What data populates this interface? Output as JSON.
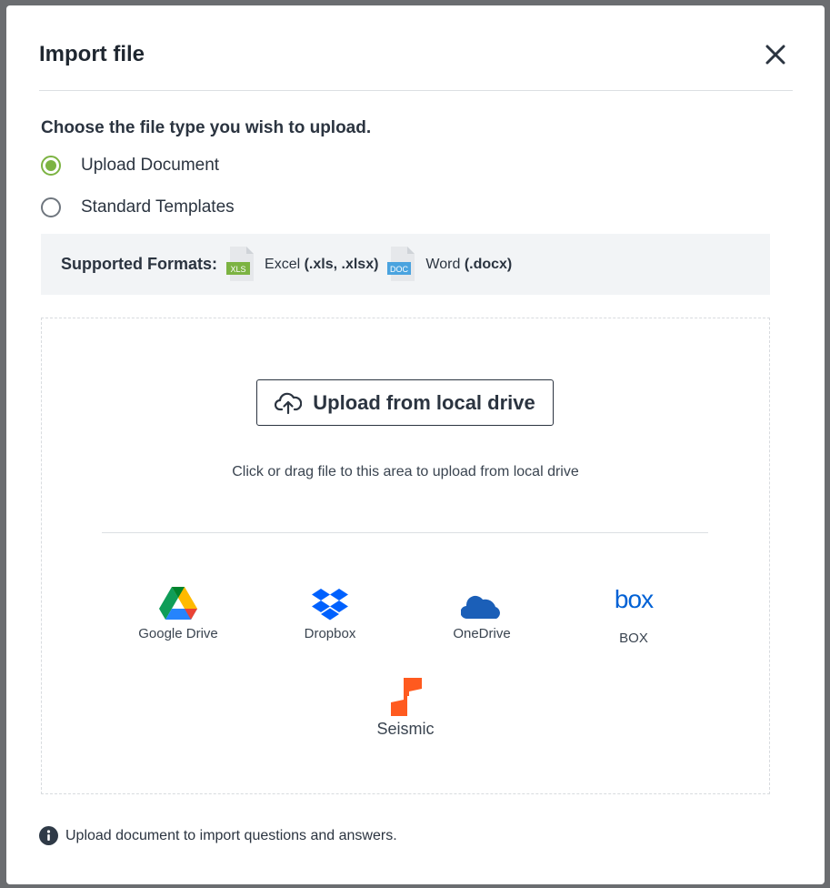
{
  "dialog": {
    "title": "Import file",
    "close_icon": "close-icon"
  },
  "file_type": {
    "prompt": "Choose the file type you wish to upload.",
    "options": [
      {
        "label": "Upload Document",
        "selected": true
      },
      {
        "label": "Standard Templates",
        "selected": false
      }
    ]
  },
  "formats": {
    "title": "Supported Formats:",
    "items": [
      {
        "icon": "xls-file-icon",
        "badge": "XLS",
        "name": "Excel",
        "ext": "(.xls, .xlsx)"
      },
      {
        "icon": "doc-file-icon",
        "badge": "DOC",
        "name": "Word",
        "ext": "(.docx)"
      }
    ]
  },
  "dropzone": {
    "upload_button": "Upload from local drive",
    "hint": "Click or drag file to this area to upload from local drive",
    "providers": [
      {
        "icon": "google-drive-icon",
        "label": "Google Drive"
      },
      {
        "icon": "dropbox-icon",
        "label": "Dropbox"
      },
      {
        "icon": "onedrive-icon",
        "label": "OneDrive"
      },
      {
        "icon": "box-icon",
        "logo_text": "box",
        "label": "BOX"
      },
      {
        "icon": "seismic-icon",
        "label": "Seismic"
      }
    ]
  },
  "footer": {
    "note": "Upload document to import questions and answers."
  },
  "colors": {
    "accent": "#7cb342",
    "text": "#2b3440",
    "xls": "#7cb342",
    "doc": "#4aa3df",
    "dropbox": "#0061fe",
    "onedrive": "#1b5fb8",
    "box": "#0061d5",
    "seismic": "#ff5a1f"
  }
}
